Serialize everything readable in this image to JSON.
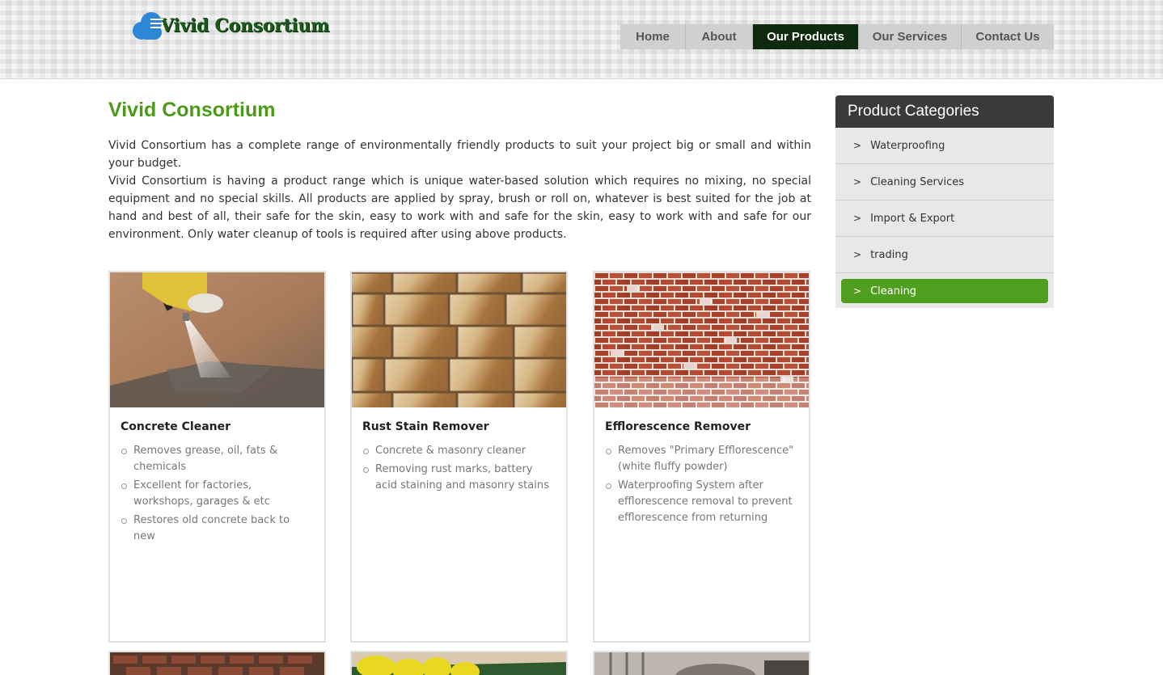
{
  "header": {
    "logo_text": "Vivid Consortium",
    "nav": [
      {
        "label": "Home",
        "active": false
      },
      {
        "label": "About",
        "active": false
      },
      {
        "label": "Our Products",
        "active": true
      },
      {
        "label": "Our Services",
        "active": false
      },
      {
        "label": "Contact Us",
        "active": false
      }
    ]
  },
  "main": {
    "title": "Vivid Consortium",
    "intro": [
      "Vivid Consortium has a complete range of environmentally friendly products to suit your project big or small and within your budget.",
      "Vivid Consortium is having a product range which is unique water-based solution which requires no mixing, no special equipment and no special skills. All products are applied by spray, brush or roll on, whatever is best suited for the job at hand and best of all, their safe for the skin, easy to work with and safe for the skin, easy to work with and safe for our environment. Only water cleanup of tools is required after using above products."
    ],
    "products": [
      {
        "name": "Concrete Cleaner",
        "features": [
          "Removes grease, oil, fats & chemicals",
          "Excellent for factories, workshops, garages & etc",
          "Restores old concrete back to new"
        ]
      },
      {
        "name": "Rust Stain Remover",
        "features": [
          "Concrete & masonry cleaner",
          "Removing rust marks, battery acid staining and masonry stains"
        ]
      },
      {
        "name": "Efflorescence Remover",
        "features": [
          "Removes \"Primary Efflorescence\" (white fluffy powder)",
          "Waterproofing System after efflorescence removal to prevent efflorescence from returning"
        ]
      }
    ]
  },
  "sidebar": {
    "title": "Product Categories",
    "items": [
      {
        "label": "Waterproofing",
        "active": false
      },
      {
        "label": "Cleaning Services",
        "active": false
      },
      {
        "label": "Import & Export",
        "active": false
      },
      {
        "label": "trading",
        "active": false
      },
      {
        "label": "Cleaning",
        "active": true
      }
    ]
  },
  "colors": {
    "accent_green": "#4f9e1e",
    "title_green": "#4d9a1a",
    "nav_active": "#0e2a0c",
    "sidebar_header": "#3a3a3a"
  }
}
